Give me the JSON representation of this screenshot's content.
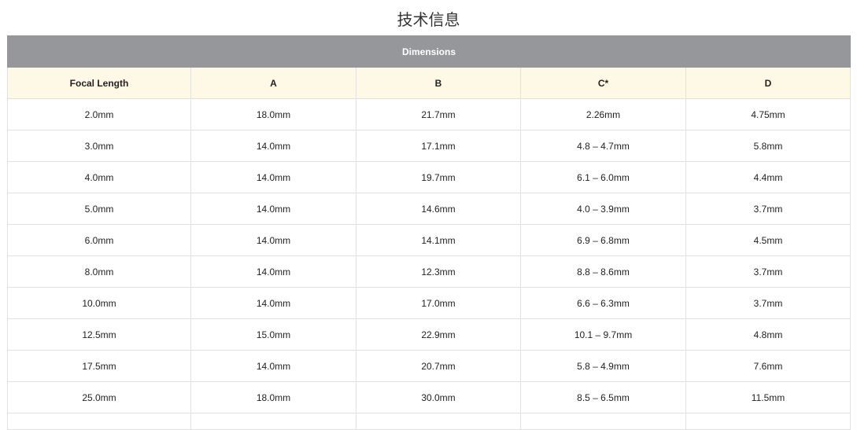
{
  "page": {
    "title": "技术信息"
  },
  "table": {
    "group_header": "Dimensions",
    "columns": [
      "Focal Length",
      "A",
      "B",
      "C*",
      "D"
    ],
    "rows": [
      [
        "2.0mm",
        "18.0mm",
        "21.7mm",
        "2.26mm",
        "4.75mm"
      ],
      [
        "3.0mm",
        "14.0mm",
        "17.1mm",
        "4.8 – 4.7mm",
        "5.8mm"
      ],
      [
        "4.0mm",
        "14.0mm",
        "19.7mm",
        "6.1 – 6.0mm",
        "4.4mm"
      ],
      [
        "5.0mm",
        "14.0mm",
        "14.6mm",
        "4.0 – 3.9mm",
        "3.7mm"
      ],
      [
        "6.0mm",
        "14.0mm",
        "14.1mm",
        "6.9 – 6.8mm",
        "4.5mm"
      ],
      [
        "8.0mm",
        "14.0mm",
        "12.3mm",
        "8.8 – 8.6mm",
        "3.7mm"
      ],
      [
        "10.0mm",
        "14.0mm",
        "17.0mm",
        "6.6 – 6.3mm",
        "3.7mm"
      ],
      [
        "12.5mm",
        "15.0mm",
        "22.9mm",
        "10.1 – 9.7mm",
        "4.8mm"
      ],
      [
        "17.5mm",
        "14.0mm",
        "20.7mm",
        "5.8 – 4.9mm",
        "7.6mm"
      ],
      [
        "25.0mm",
        "18.0mm",
        "30.0mm",
        "8.5 – 6.5mm",
        "11.5mm"
      ]
    ]
  }
}
